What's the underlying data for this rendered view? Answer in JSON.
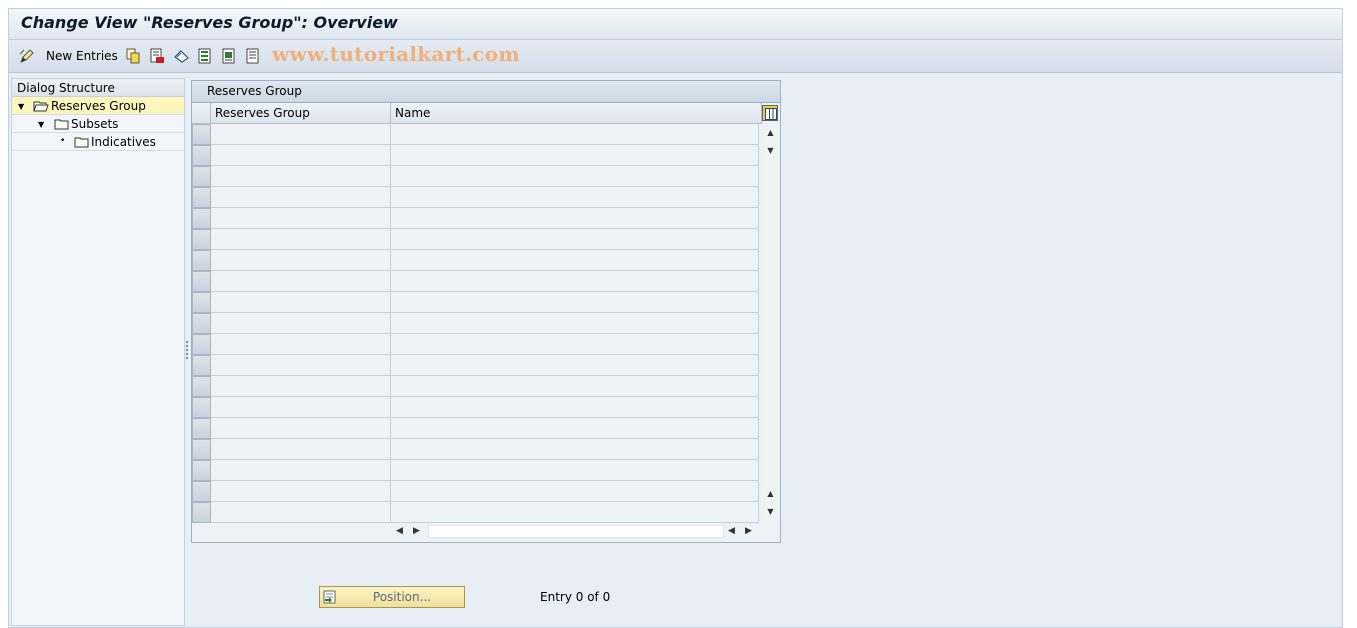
{
  "window": {
    "title": "Change View \"Reserves Group\": Overview"
  },
  "toolbar": {
    "new_entries_label": "New Entries",
    "watermark": "www.tutorialkart.com",
    "icons": [
      "edit-icon",
      "copy-icon",
      "delete-icon",
      "undo-icon",
      "select-all-icon",
      "select-block-icon",
      "deselect-all-icon"
    ]
  },
  "dialog_structure": {
    "header": "Dialog Structure",
    "items": [
      {
        "label": "Reserves Group",
        "level": 0,
        "expanded": true,
        "selected": true
      },
      {
        "label": "Subsets",
        "level": 1,
        "expanded": true,
        "selected": false
      },
      {
        "label": "Indicatives",
        "level": 2,
        "expanded": false,
        "selected": false
      }
    ]
  },
  "table": {
    "title": "Reserves Group",
    "columns": [
      "Reserves Group",
      "Name"
    ],
    "rows": []
  },
  "footer": {
    "position_button": "Position...",
    "entry_text": "Entry 0 of 0"
  },
  "colors": {
    "background": "#e8eef5",
    "selected_row": "#fcf6bd",
    "button_yellow": "#f0e29c",
    "watermark": "#f0b07a"
  }
}
